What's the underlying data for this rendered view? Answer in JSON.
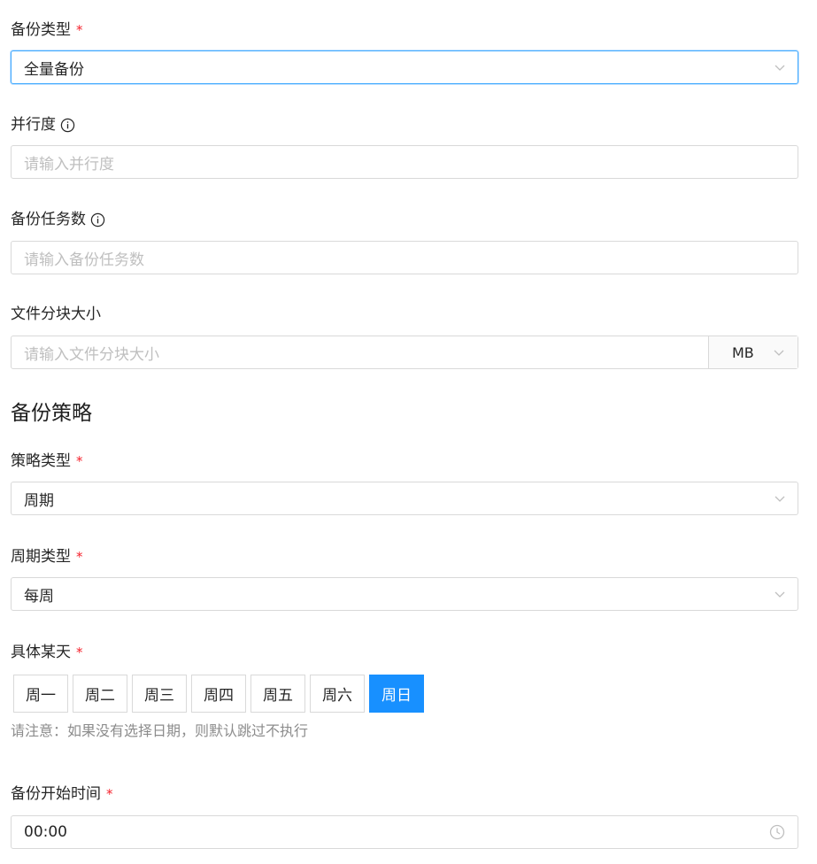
{
  "backup_type": {
    "label": "备份类型",
    "required_mark": "*",
    "value": "全量备份"
  },
  "parallelism": {
    "label": "并行度",
    "placeholder": "请输入并行度"
  },
  "backup_tasks": {
    "label": "备份任务数",
    "placeholder": "请输入备份任务数"
  },
  "chunk_size": {
    "label": "文件分块大小",
    "placeholder": "请输入文件分块大小",
    "unit": "MB"
  },
  "section_title": "备份策略",
  "strategy_type": {
    "label": "策略类型",
    "required_mark": "*",
    "value": "周期"
  },
  "cycle_type": {
    "label": "周期类型",
    "required_mark": "*",
    "value": "每周"
  },
  "specific_day": {
    "label": "具体某天",
    "required_mark": "*",
    "days": [
      "周一",
      "周二",
      "周三",
      "周四",
      "周五",
      "周六",
      "周日"
    ],
    "selected": "周日",
    "note": "请注意：如果没有选择日期，则默认跳过不执行"
  },
  "start_time": {
    "label": "备份开始时间",
    "required_mark": "*",
    "value": "00:00"
  },
  "colors": {
    "accent": "#1890ff",
    "required": "#f5222d",
    "border": "#d9d9d9",
    "placeholder": "#bfbfbf"
  },
  "icons": {
    "select": "chevron-down-icon",
    "info": "info-icon",
    "time": "clock-icon"
  }
}
